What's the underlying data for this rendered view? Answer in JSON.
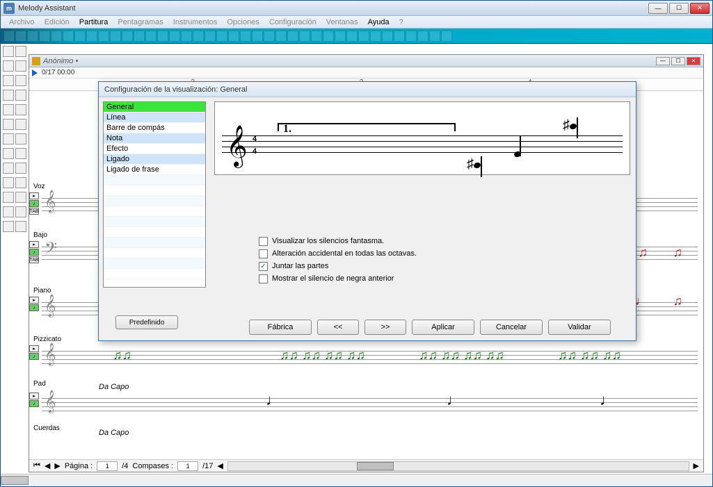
{
  "app": {
    "title": "Melody Assistant",
    "icon_letter": "m"
  },
  "menubar": {
    "items": [
      "Archivo",
      "Edición",
      "Partitura",
      "Pentagramas",
      "Instrumentos",
      "Opciones",
      "Configuración",
      "Ventanas",
      "Ayuda",
      "?"
    ],
    "active_indices": [
      2,
      8
    ]
  },
  "document": {
    "title": "Anónimo •",
    "time": "0/17 00:00",
    "ruler_marks": [
      {
        "pos": 24,
        "label": "2"
      },
      {
        "pos": 49,
        "label": "3"
      },
      {
        "pos": 74,
        "label": "4"
      }
    ],
    "tracks": [
      "Voz",
      "Bajo",
      "Piano",
      "Pizzicato",
      "Pad",
      "Cuerdas"
    ],
    "dacapo": "Da Capo",
    "tab_marker": "TAB"
  },
  "statusbar": {
    "page_label": "Página :",
    "page_current": "1",
    "page_total": "/4",
    "measures_label": "Compases :",
    "measure_current": "1",
    "measure_total": "/17"
  },
  "dialog": {
    "title": "Configuración de la visualización: General",
    "categories": [
      {
        "label": "General",
        "state": "selected"
      },
      {
        "label": "Línea",
        "state": "hl"
      },
      {
        "label": "Barre de compás",
        "state": ""
      },
      {
        "label": "Nota",
        "state": "hl"
      },
      {
        "label": "Efecto",
        "state": ""
      },
      {
        "label": "Ligado",
        "state": "hl"
      },
      {
        "label": "Ligado de frase",
        "state": ""
      }
    ],
    "predef_button": "Predefinido",
    "preview": {
      "time_top": "4",
      "time_bottom": "4",
      "volta": "1."
    },
    "checkboxes": [
      {
        "label": "Visualizar los silencios fantasma.",
        "checked": false
      },
      {
        "label": "Alteración accidental en todas las octavas.",
        "checked": false
      },
      {
        "label": "Juntar las partes",
        "checked": true
      },
      {
        "label": "Mostrar el silencio de negra anterior",
        "checked": false
      }
    ],
    "buttons": {
      "factory": "Fábrica",
      "prev": "<<",
      "next": ">>",
      "apply": "Aplicar",
      "cancel": "Cancelar",
      "validate": "Validar"
    }
  }
}
